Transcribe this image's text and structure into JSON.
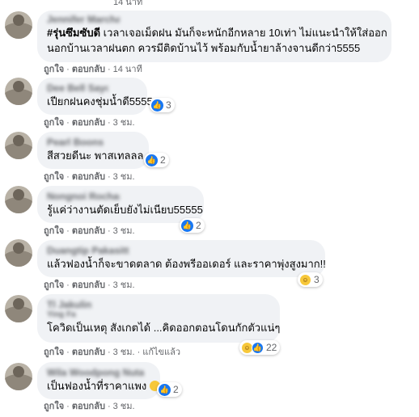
{
  "comments": [
    {
      "author": "Jennifer Marchant",
      "hashtag": "#รุ่นซึมซับดี",
      "line1": " เวลาเจอเม็ดฝน มันก็จะหนักอีกหลาย 10เท่า ไม่แนะนำให้ใส่ออก",
      "line2": "นอกบ้านเวลาฝนตก ควรมีติดบ้านไว้ พร้อมกับน้ำยาล้างจานดีกว่า5555",
      "like": "ถูกใจ",
      "reply": "ตอบกลับ",
      "time": "14 นาที",
      "top_time": "14 นาที"
    },
    {
      "author": "Dee Bell Sayo",
      "text": "เปียกฝนคงชุ่มน้ำดี5555",
      "like": "ถูกใจ",
      "reply": "ตอบกลับ",
      "time": "3 ชม.",
      "reactions": "3"
    },
    {
      "author": "Pearl Boonsak",
      "text": "สีสวยดีนะ พาสเทลลล",
      "like": "ถูกใจ",
      "reply": "ตอบกลับ",
      "time": "3 ชม.",
      "reactions": "2"
    },
    {
      "author": "Nongnoi Rochana",
      "text": "รู้แค่ว่างานตัดเย็บยังไม่เนียบ55555",
      "like": "ถูกใจ",
      "reply": "ตอบกลับ",
      "time": "3 ชม.",
      "reactions": "2"
    },
    {
      "author": "Duangtip Pakasitt",
      "text": "แล้วฟองน้ำก็จะขาดตลาด ต้องพรีออเดอร์ และราคาพุ่งสูงมาก!!",
      "like": "ถูกใจ",
      "reply": "ตอบกลับ",
      "time": "3 ชม.",
      "reactions": "3"
    },
    {
      "author": "Tl Jakulin",
      "sub": "Ying Fa",
      "text": "โควิดเป็นเหตุ สังเกตได้ ...คิดออกตอนโดนกักตัวแน่ๆ",
      "like": "ถูกใจ",
      "reply": "ตอบกลับ",
      "time": "3 ชม.",
      "edited": "แก้ไขแล้ว",
      "reactions": "22"
    },
    {
      "author": "Wila Woodpong Nutam",
      "text": "เป็นฟองน้ำที่ราคาแพง",
      "like": "ถูกใจ",
      "reply": "ตอบกลับ",
      "time": "3 ชม.",
      "reactions": "2"
    }
  ],
  "colors": {
    "like_blue": "#1877f2",
    "bubble": "#f0f2f5",
    "meta": "#65676b"
  },
  "icons": {
    "like": "like-icon",
    "haha": "haha-icon",
    "laugh_emoji": "grinning-face-icon"
  }
}
